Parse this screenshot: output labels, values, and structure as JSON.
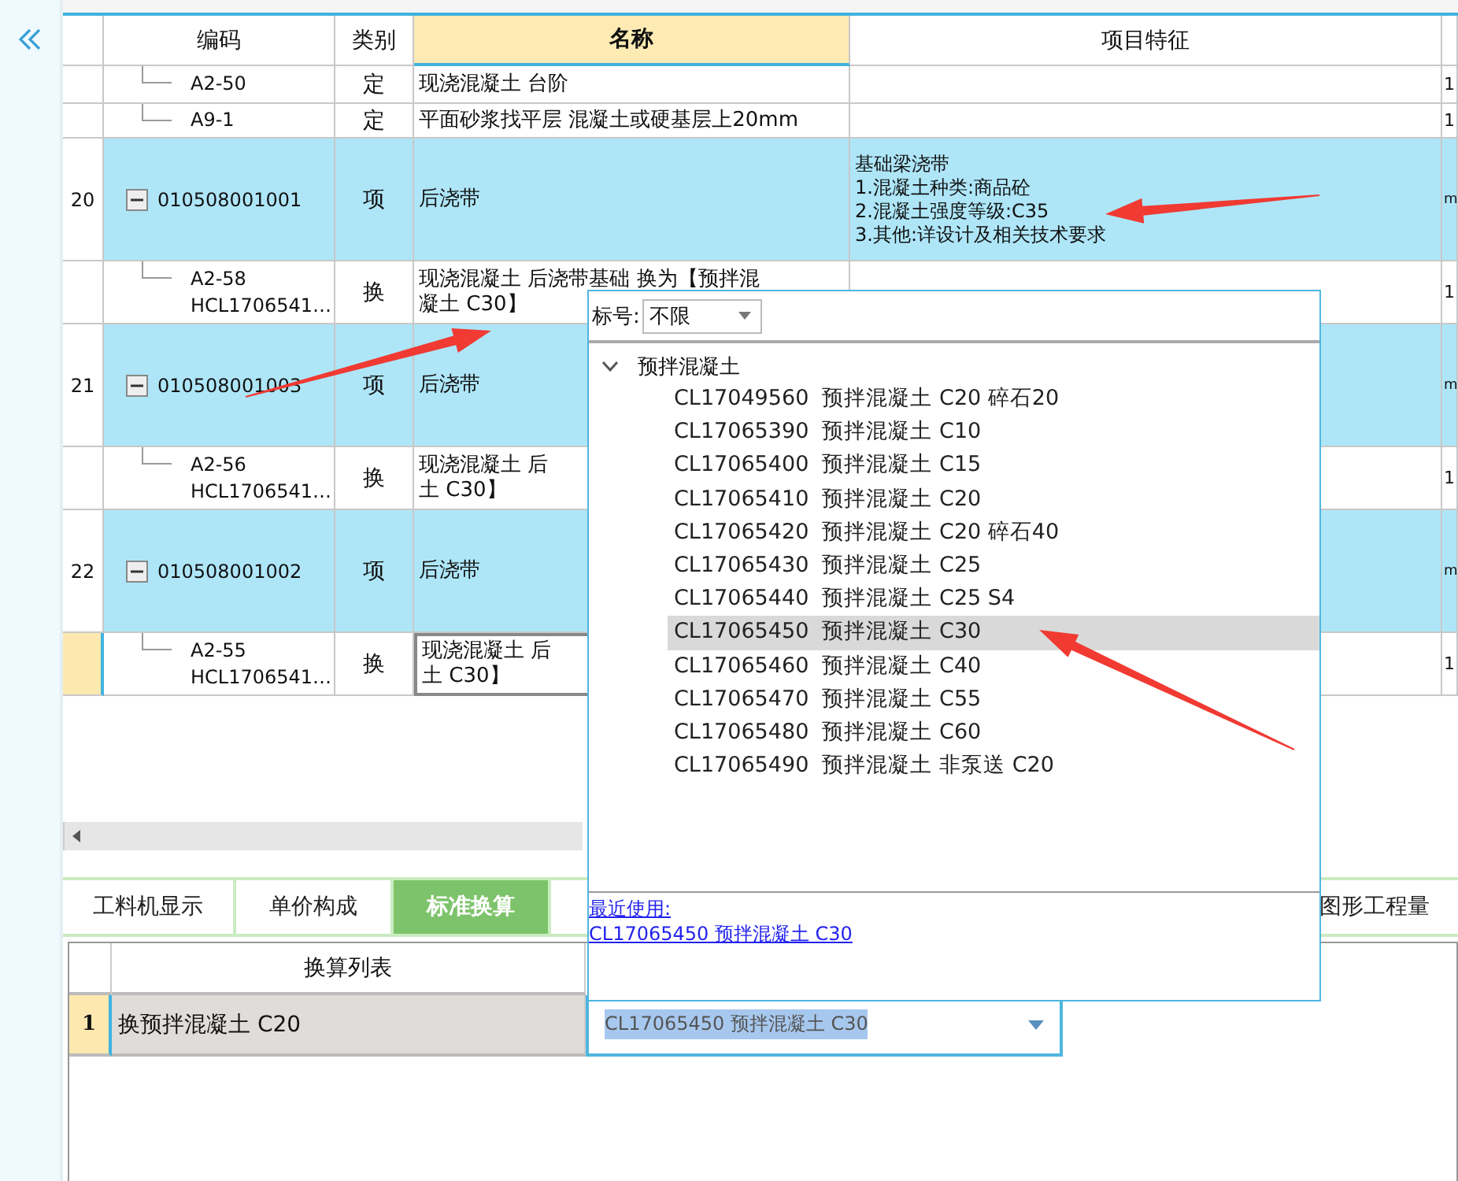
{
  "table": {
    "columns": [
      {
        "label": "编码",
        "selected": false
      },
      {
        "label": "类别",
        "selected": false
      },
      {
        "label": "名称",
        "selected": true
      },
      {
        "label": "项目特征",
        "selected": false
      }
    ],
    "rows": [
      {
        "kind": "sub",
        "row_number": "",
        "code": [
          "A2-50"
        ],
        "type": "定",
        "name": [
          "现浇混凝土 台阶"
        ],
        "features": [],
        "column_6": "1",
        "selected": false
      },
      {
        "kind": "sub",
        "row_number": "",
        "code": [
          "A9-1"
        ],
        "type": "定",
        "name": [
          "平面砂浆找平层 混凝土或硬基层上20mm"
        ],
        "features": [],
        "column_6": "1",
        "selected": false
      },
      {
        "kind": "item",
        "row_number": "20",
        "code": [
          "010508001001"
        ],
        "type": "项",
        "name": [
          "后浇带"
        ],
        "features": [
          "基础梁浇带",
          "1.混凝土种类:商品砼",
          "2.混凝土强度等级:C35",
          "3.其他:详设计及相关技术要求"
        ],
        "column_6": "m",
        "selected": false,
        "expanded": true
      },
      {
        "kind": "sub",
        "row_number": "",
        "code": [
          "A2-58",
          "HCL1706541…"
        ],
        "type": "换",
        "name": [
          "现浇混凝土 后浇带基础  换为【预拌混",
          "凝土 C30】"
        ],
        "features": [],
        "column_6": "1",
        "selected": false
      },
      {
        "kind": "item",
        "row_number": "21",
        "code": [
          "010508001003"
        ],
        "type": "项",
        "name": [
          "后浇带"
        ],
        "features": [],
        "column_6": "m",
        "selected": false,
        "expanded": true
      },
      {
        "kind": "sub",
        "row_number": "",
        "code": [
          "A2-56",
          "HCL1706541…"
        ],
        "type": "换",
        "name": [
          "现浇混凝土 后",
          "土 C30】"
        ],
        "features": [],
        "column_6": "1",
        "selected": false
      },
      {
        "kind": "item",
        "row_number": "22",
        "code": [
          "010508001002"
        ],
        "type": "项",
        "name": [
          "后浇带"
        ],
        "features": [],
        "column_6": "m",
        "selected": false,
        "expanded": true
      },
      {
        "kind": "sub",
        "row_number": "",
        "code": [
          "A2-55",
          "HCL1706541…"
        ],
        "type": "换",
        "name": [
          "现浇混凝土 后",
          "土 C30】"
        ],
        "features": [],
        "column_6": "1",
        "selected": true
      }
    ]
  },
  "tabs": [
    {
      "label": "工料机显示",
      "selected": false
    },
    {
      "label": "单价构成",
      "selected": false
    },
    {
      "label": "标准换算",
      "selected": true
    },
    {
      "label": "图形工程量",
      "selected": false
    }
  ],
  "conversion": {
    "column": "换算列表",
    "rows": [
      {
        "number": "1",
        "label": "换预拌混凝土 C20",
        "value": "CL17065450  预拌混凝土 C30",
        "selected": true
      }
    ]
  },
  "popup": {
    "filter_label": "标号:",
    "filter_value": "不限",
    "group": {
      "label": "预拌混凝土",
      "expanded": true,
      "children": [
        {
          "code": "CL17049560",
          "name": "预拌混凝土 C20 碎石20",
          "selected": false
        },
        {
          "code": "CL17065390",
          "name": "预拌混凝土 C10",
          "selected": false
        },
        {
          "code": "CL17065400",
          "name": "预拌混凝土 C15",
          "selected": false
        },
        {
          "code": "CL17065410",
          "name": "预拌混凝土 C20",
          "selected": false
        },
        {
          "code": "CL17065420",
          "name": "预拌混凝土 C20 碎石40",
          "selected": false
        },
        {
          "code": "CL17065430",
          "name": "预拌混凝土 C25",
          "selected": false
        },
        {
          "code": "CL17065440",
          "name": "预拌混凝土 C25 S4",
          "selected": false
        },
        {
          "code": "CL17065450",
          "name": "预拌混凝土 C30",
          "selected": true
        },
        {
          "code": "CL17065460",
          "name": "预拌混凝土 C40",
          "selected": false
        },
        {
          "code": "CL17065470",
          "name": "预拌混凝土 C55",
          "selected": false
        },
        {
          "code": "CL17065480",
          "name": "预拌混凝土 C60",
          "selected": false
        },
        {
          "code": "CL17065490",
          "name": "预拌混凝土 非泵送 C20",
          "selected": false
        }
      ]
    },
    "recent_label": "最近使用:",
    "recent_link": "CL17065450 预拌混凝土 C30"
  }
}
